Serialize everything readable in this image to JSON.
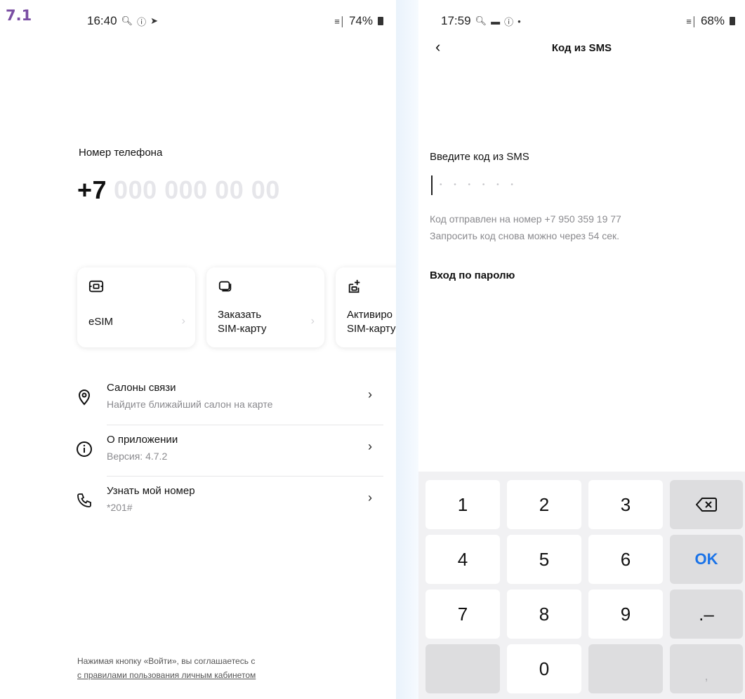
{
  "figure_label": "7.1",
  "left_screen": {
    "status": {
      "time": "16:40",
      "battery": "74%"
    },
    "phone_label": "Номер телефона",
    "phone_prefix": "+7",
    "phone_placeholder": "000 000 00 00",
    "cards": [
      {
        "title": "eSIM",
        "icon": "esim-icon"
      },
      {
        "title": "Заказать\nSIM-карту",
        "icon": "sim-order-icon"
      },
      {
        "title": "Активиро\nSIM-карту",
        "icon": "sim-activate-icon"
      }
    ],
    "menu": [
      {
        "title": "Салоны связи",
        "subtitle": "Найдите ближайший салон на карте",
        "icon": "location-pin-icon"
      },
      {
        "title": "О приложении",
        "subtitle": "Версия: 4.7.2",
        "icon": "info-icon"
      },
      {
        "title": "Узнать мой номер",
        "subtitle": "*201#",
        "icon": "phone-icon"
      }
    ],
    "footer": {
      "line1": "Нажимая кнопку «Войти», вы соглашаетесь с",
      "link": "с правилами пользования личным кабинетом"
    }
  },
  "right_screen": {
    "status": {
      "time": "17:59",
      "battery": "68%"
    },
    "nav_title": "Код из SMS",
    "sms_label": "Введите код из SMS",
    "code_placeholder": "• • • • • •",
    "info_line1": "Код отправлен на номер +7 950 359 19 77",
    "info_line2": "Запросить код снова можно через 54 сек.",
    "password_link": "Вход по паролю",
    "keypad": {
      "keys": [
        "1",
        "2",
        "3",
        "4",
        "5",
        "6",
        "7",
        "8",
        "9",
        "0"
      ],
      "ok": "OK",
      "symbols": ".–",
      "comma": ","
    }
  },
  "colors": {
    "accent_blue": "#1a73e8",
    "figure_label": "#7a4ea3"
  }
}
